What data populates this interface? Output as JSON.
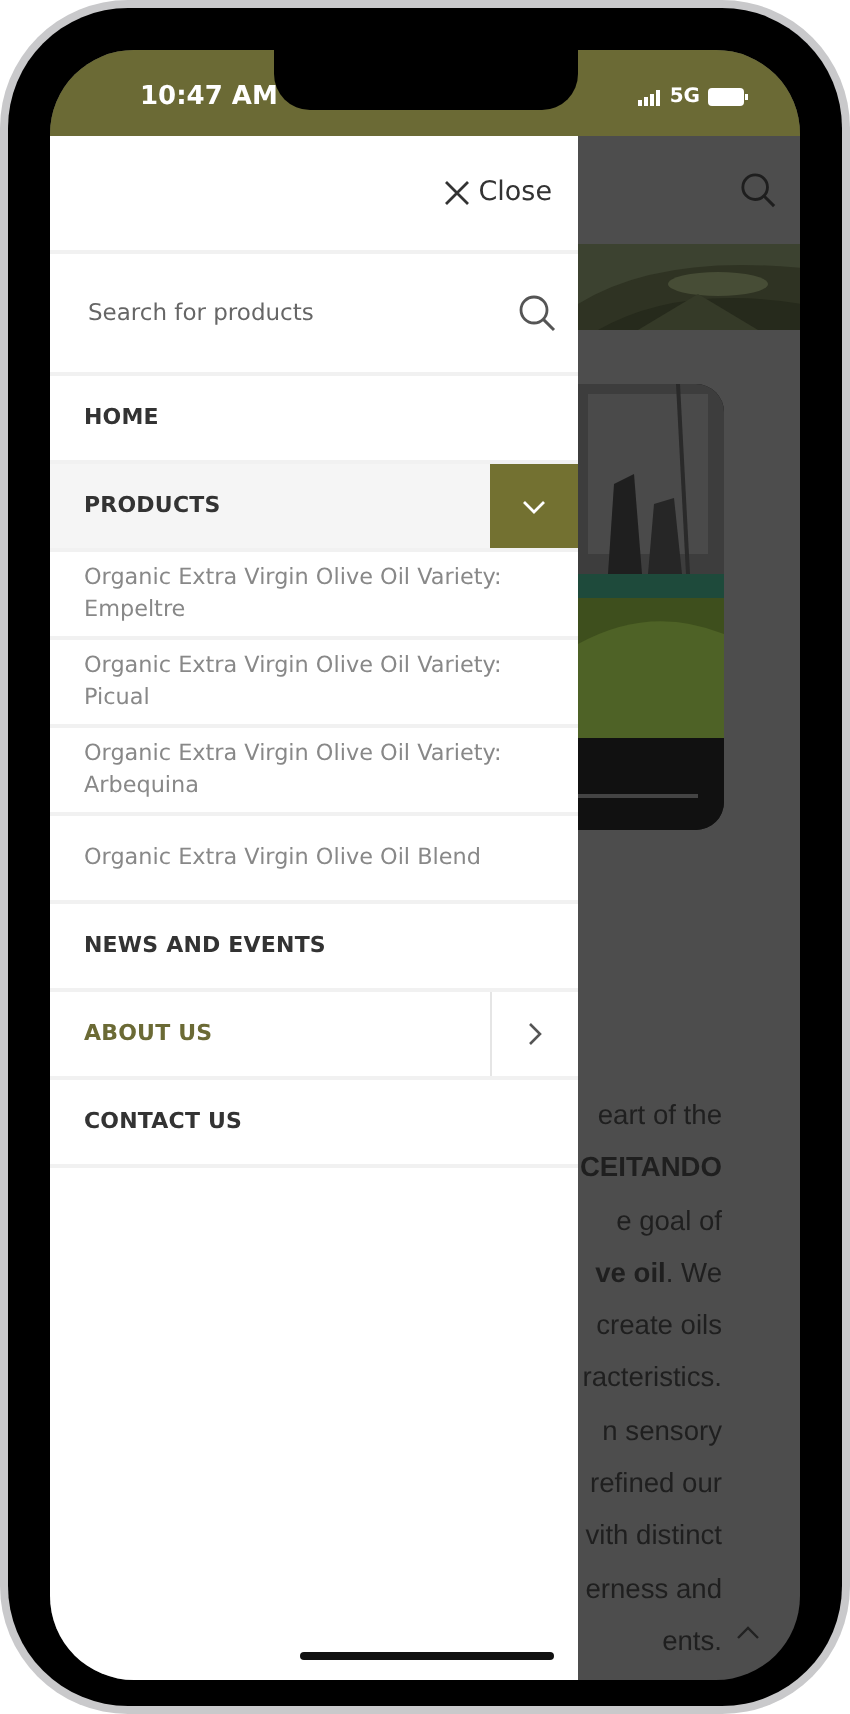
{
  "status_bar": {
    "time": "10:47 AM",
    "network": "5G"
  },
  "drawer": {
    "close_label": "Close",
    "search": {
      "placeholder": "Search for products"
    },
    "menu": [
      {
        "label": "HOME",
        "kind": "link",
        "selected": false
      },
      {
        "label": "PRODUCTS",
        "kind": "parent",
        "selected": false,
        "expanded": true,
        "children": [
          {
            "label": "Organic Extra Virgin Olive Oil Variety: Empeltre"
          },
          {
            "label": "Organic Extra Virgin Olive Oil Variety: Picual"
          },
          {
            "label": "Organic Extra Virgin Olive Oil Variety: Arbequina"
          },
          {
            "label": "Organic Extra Virgin Olive Oil Blend"
          }
        ]
      },
      {
        "label": "NEWS AND EVENTS",
        "kind": "link",
        "selected": false
      },
      {
        "label": "ABOUT US",
        "kind": "parent",
        "selected": true,
        "expanded": false
      },
      {
        "label": "CONTACT US",
        "kind": "link",
        "selected": false
      }
    ]
  },
  "page_behind": {
    "text_lines": [
      "eart of the",
      "**CEITANDO**",
      "e goal of",
      "**ve oil**. We",
      "create oils",
      "racteristics.",
      "n sensory",
      "refined our",
      "vith distinct",
      "erness and",
      "ents."
    ]
  }
}
